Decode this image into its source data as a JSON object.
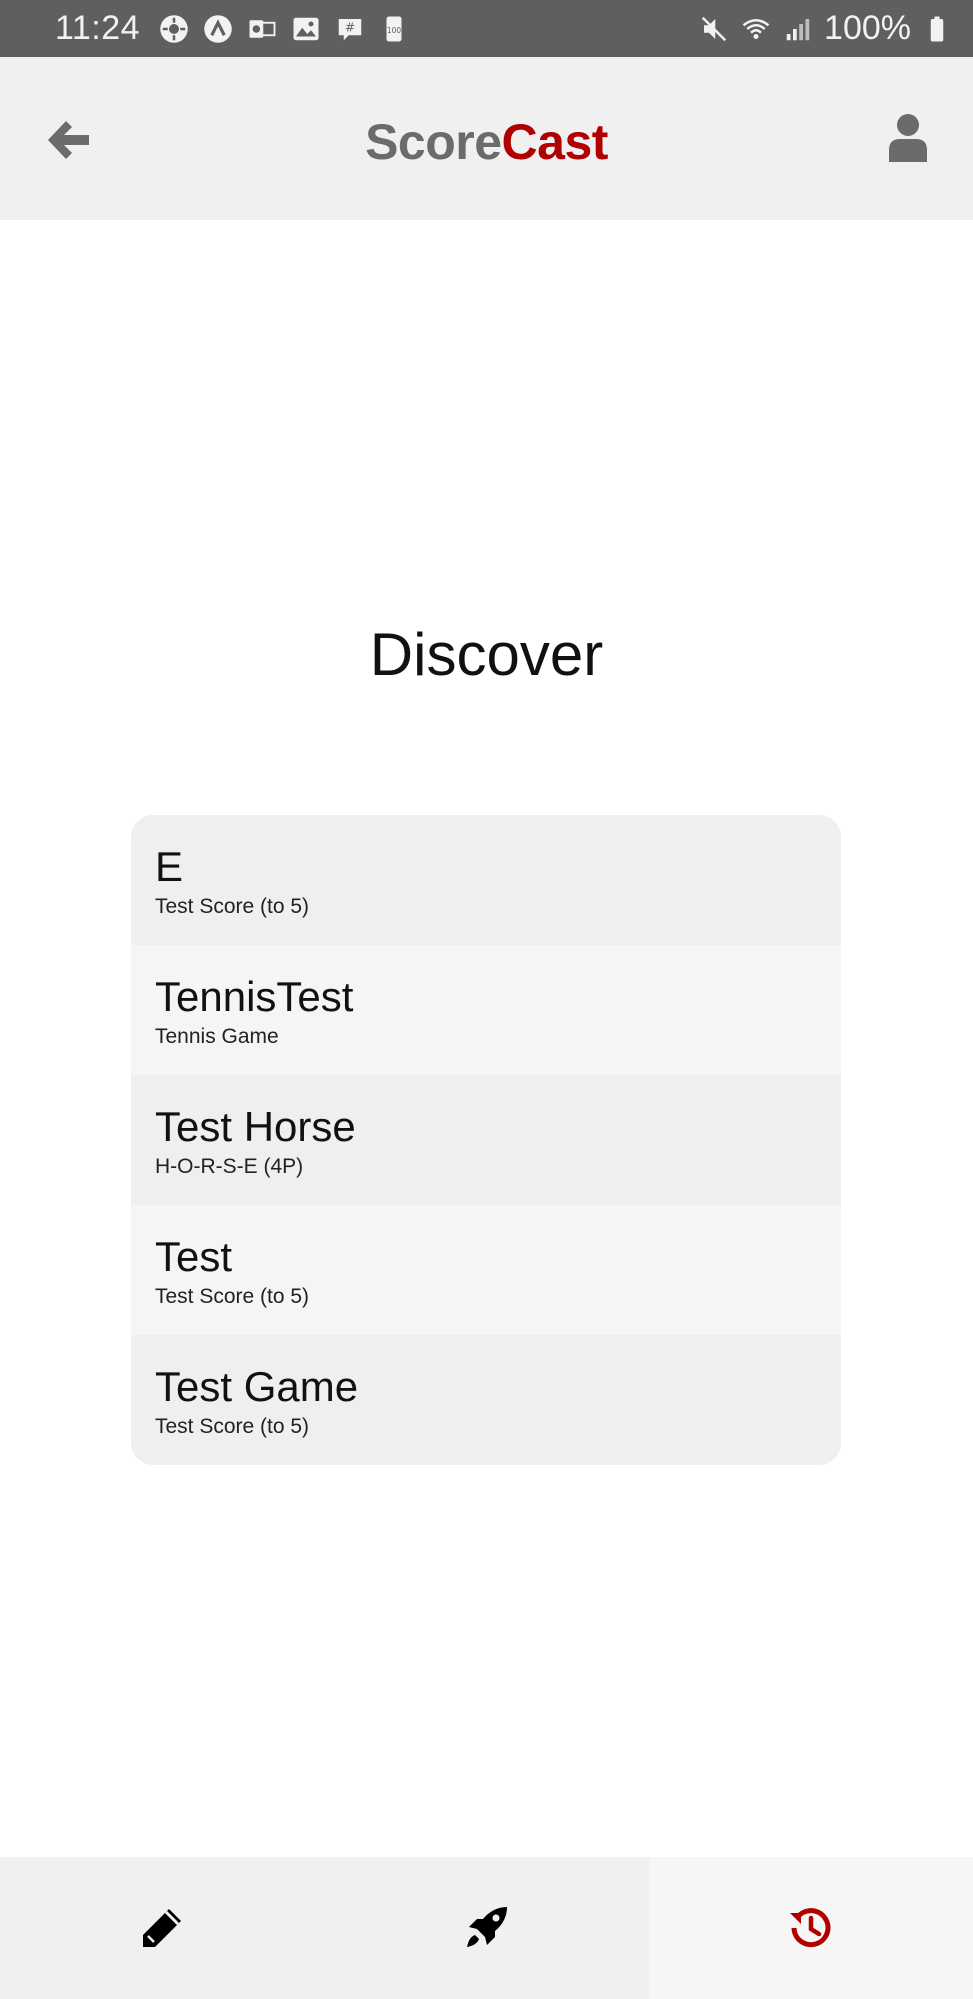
{
  "status_bar": {
    "time": "11:24",
    "battery": "100%",
    "icons_left": [
      "settings-icon",
      "app-icon",
      "outlook-icon",
      "gallery-icon",
      "slack-icon",
      "battery-100-icon"
    ],
    "icons_right": [
      "mute-icon",
      "wifi-icon",
      "signal-icon",
      "battery-icon"
    ]
  },
  "header": {
    "brand_part1": "Score",
    "brand_part2": "Cast",
    "back_icon": "arrow-left-icon",
    "user_icon": "user-icon",
    "brand_colors": {
      "part1": "#6b6b6b",
      "part2": "#b00000"
    }
  },
  "page": {
    "title": "Discover"
  },
  "games": [
    {
      "name": "E",
      "type": "Test Score (to 5)"
    },
    {
      "name": "TennisTest",
      "type": "Tennis Game"
    },
    {
      "name": "Test Horse",
      "type": "H-O-R-S-E (4P)"
    },
    {
      "name": "Test",
      "type": "Test Score (to 5)"
    },
    {
      "name": "Test Game",
      "type": "Test Score (to 5)"
    }
  ],
  "bottom_nav": {
    "tabs": [
      {
        "icon": "pencil-icon",
        "active": false
      },
      {
        "icon": "rocket-icon",
        "active": false
      },
      {
        "icon": "history-icon",
        "active": true
      }
    ],
    "active_color": "#b00000"
  }
}
